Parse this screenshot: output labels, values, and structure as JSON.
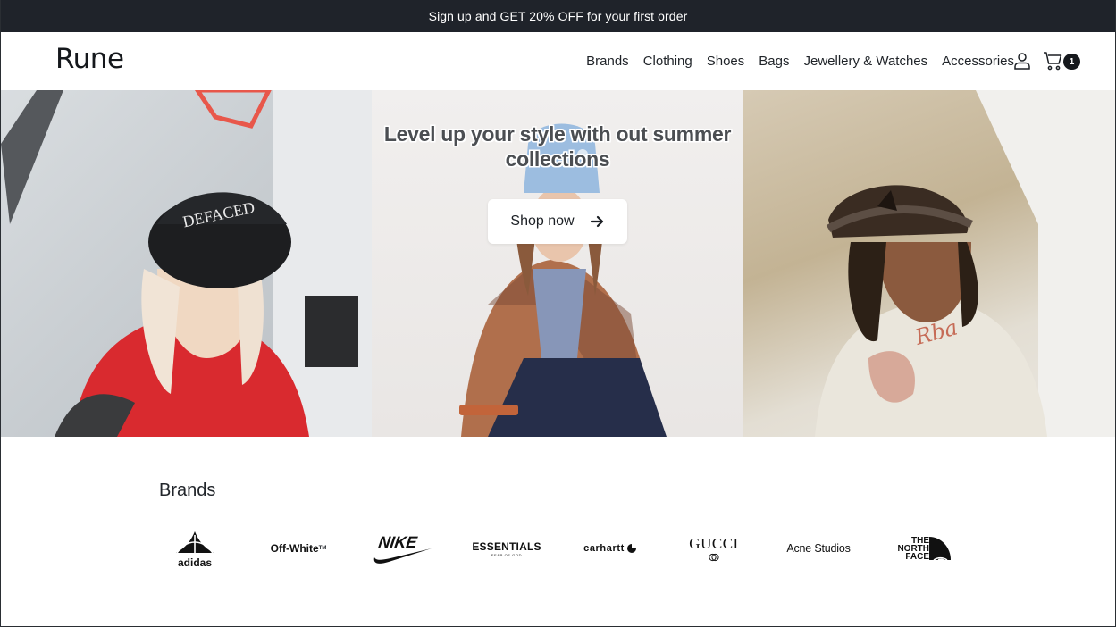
{
  "promo": {
    "text": "Sign up and GET 20% OFF for your first order"
  },
  "header": {
    "logo": "Rune",
    "nav": [
      {
        "label": "Brands"
      },
      {
        "label": "Clothing"
      },
      {
        "label": "Shoes"
      },
      {
        "label": "Bags"
      },
      {
        "label": "Jewellery & Watches"
      },
      {
        "label": "Accessories"
      }
    ],
    "icons": {
      "account": "user-icon",
      "cart": "cart-icon"
    },
    "cart_count": "1"
  },
  "hero": {
    "headline": "Level up your style with out summer collections",
    "cta_label": "Shop now",
    "cta_icon": "arrow-right-icon"
  },
  "brands": {
    "title": "Brands",
    "logos": [
      {
        "name": "adidas"
      },
      {
        "name": "Off-White",
        "mark": "TM"
      },
      {
        "name": "NIKE"
      },
      {
        "name": "ESSENTIALS",
        "tagline": "FEAR OF GOD"
      },
      {
        "name": "carhartt"
      },
      {
        "name": "GUCCI"
      },
      {
        "name": "Acne Studios"
      },
      {
        "name": "THE NORTH FACE"
      }
    ]
  },
  "colors": {
    "promo_bg": "#1f232a",
    "text": "#1b1f24",
    "white": "#ffffff"
  }
}
